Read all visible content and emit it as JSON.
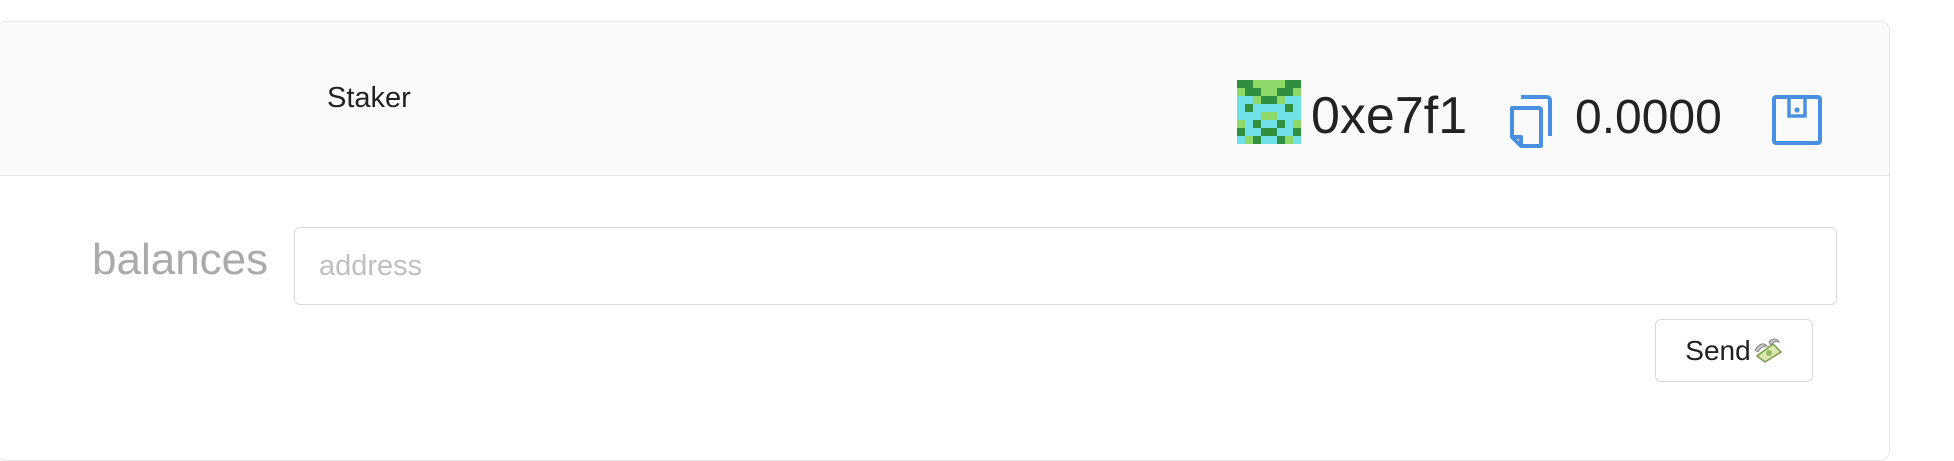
{
  "header": {
    "title": "Staker",
    "account": {
      "address_short": "0xe7f1",
      "balance": "0.0000",
      "blockie_colors": {
        "dark": "#2f8f3f",
        "light": "#8fd86a",
        "cyan": "#6fe0e6"
      },
      "copy_icon": "copy-icon",
      "wallet_icon": "wallet-icon"
    }
  },
  "function_form": {
    "label": "balances",
    "input": {
      "value": "",
      "placeholder": "address"
    },
    "send_button": {
      "label": "Send",
      "icon": "money-with-wings-icon"
    }
  },
  "colors": {
    "accent": "#4a90e2",
    "muted_text": "#aaaaaa",
    "border": "#d9d9d9"
  }
}
